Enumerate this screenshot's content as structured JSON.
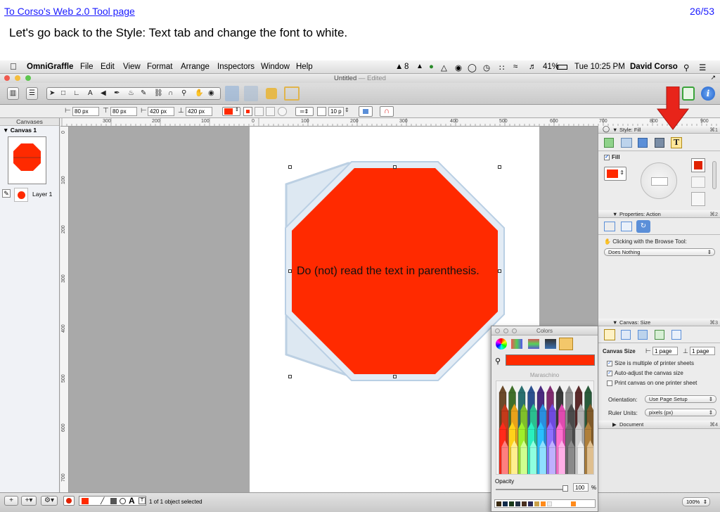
{
  "slide": {
    "back_link": "To Corso's Web 2.0 Tool page",
    "page_counter": "26/53",
    "instruction": "Let's go back to the Style: Text tab and change the font to white."
  },
  "menubar": {
    "app_name": "OmniGraffle",
    "items": [
      "File",
      "Edit",
      "View",
      "Format",
      "Arrange",
      "Inspectors",
      "Window",
      "Help"
    ],
    "ai_badge": "8",
    "battery": "41%",
    "clock": "Tue 10:25 PM",
    "user": "David Corso"
  },
  "window": {
    "title": "Untitled",
    "edited": "— Edited"
  },
  "geometry_bar": {
    "x": "80 px",
    "y": "80 px",
    "width": "420 px",
    "height": "420 px",
    "stroke_width": "10 p"
  },
  "sidebar": {
    "header": "Canvases",
    "canvas_name": "Canvas 1",
    "layer_name": "Layer 1"
  },
  "rulers": {
    "h_ticks": [
      "300",
      "200",
      "100",
      "0",
      "100",
      "200",
      "300",
      "400",
      "500",
      "600",
      "700",
      "800",
      "900"
    ],
    "v_ticks": [
      "0",
      "100",
      "200",
      "300",
      "400",
      "500",
      "600",
      "700"
    ]
  },
  "canvas": {
    "shape_text": "Do (not) read the text in parenthesis.",
    "shape_color": "#ff2a00"
  },
  "inspector": {
    "style_header": "Style: Fill",
    "style_key": "⌘1",
    "fill_label": "Fill",
    "props_header": "Properties: Action",
    "props_key": "⌘2",
    "browse_label": "Clicking with the Browse Tool:",
    "action_value": "Does Nothing",
    "canvas_header": "Canvas: Size",
    "canvas_key": "⌘3",
    "canvas_size_label": "Canvas Size",
    "width_pages": "1 page",
    "height_pages": "1 page",
    "opt_multiple": "Size is multiple of printer sheets",
    "opt_autoadjust": "Auto-adjust the canvas size",
    "opt_print_one": "Print canvas on one printer sheet",
    "orientation_label": "Orientation:",
    "orientation_value": "Use Page Setup",
    "ruler_units_label": "Ruler Units:",
    "ruler_units_value": "pixels (px)",
    "document_header": "Document",
    "document_key": "⌘4"
  },
  "colors_panel": {
    "title": "Colors",
    "color_name": "Maraschino",
    "opacity_label": "Opacity",
    "opacity_value": "100",
    "opacity_unit": "%",
    "selected_color": "#ff2a00"
  },
  "bottombar": {
    "status": "1 of 1 object selected",
    "zoom": "100%"
  }
}
